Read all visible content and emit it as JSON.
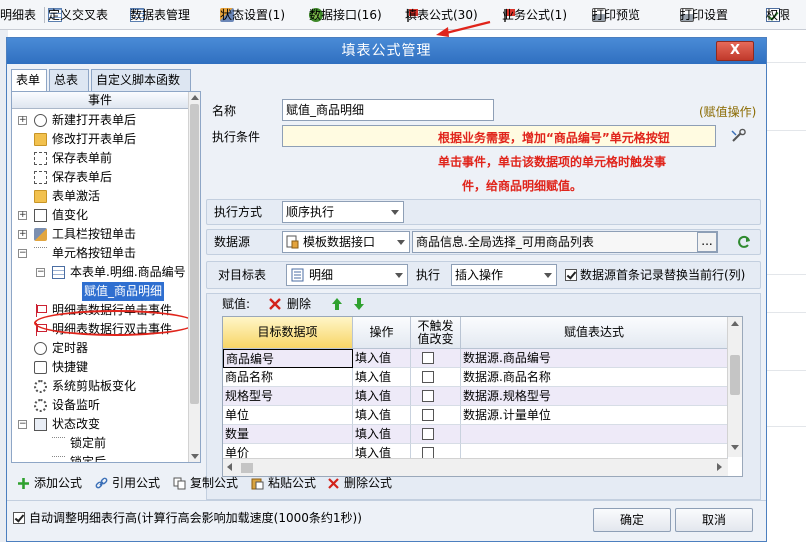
{
  "app_toolbar": {
    "items": [
      {
        "label": "明细表",
        "icon": "document-icon"
      },
      {
        "label": "定义交叉表",
        "icon": "grid-icon"
      },
      {
        "label": "数据表管理",
        "icon": "table-icon"
      },
      {
        "label": "状态设置(1)",
        "icon": "tool-icon"
      },
      {
        "label": "数据接口(16)",
        "icon": "link-icon"
      },
      {
        "label": "填表公式(30)",
        "icon": "flag-icon"
      },
      {
        "label": "业务公式(1)",
        "icon": "flag-icon"
      },
      {
        "label": "打印预览",
        "icon": "print-icon"
      },
      {
        "label": "打印设置",
        "icon": "print-icon"
      },
      {
        "label": "权限",
        "icon": "check-icon"
      }
    ]
  },
  "dialog": {
    "title": "填表公式管理",
    "close_label": "X",
    "tabs": [
      "表单",
      "总表",
      "自定义脚本函数"
    ],
    "active_tab": 0
  },
  "tree": {
    "header": "事件",
    "items": [
      {
        "label": "新建打开表单后",
        "icon": "user-icon",
        "level": 0,
        "expander": "+"
      },
      {
        "label": "修改打开表单后",
        "icon": "folder-icon",
        "level": 0,
        "expander": ""
      },
      {
        "label": "保存表单前",
        "icon": "save-icon",
        "level": 0,
        "expander": ""
      },
      {
        "label": "保存表单后",
        "icon": "save-icon",
        "level": 0,
        "expander": ""
      },
      {
        "label": "表单激活",
        "icon": "folder-icon",
        "level": 0,
        "expander": ""
      },
      {
        "label": "值变化",
        "icon": "page-icon",
        "level": 0,
        "expander": "+"
      },
      {
        "label": "工具栏按钮单击",
        "icon": "tool-icon",
        "level": 0,
        "expander": "+"
      },
      {
        "label": "单元格按钮单击",
        "icon": "dots-icon",
        "level": 0,
        "expander": "−"
      },
      {
        "label": "本表单.明细.商品编号",
        "icon": "form-icon",
        "level": 1,
        "expander": "−"
      },
      {
        "label": "赋值_商品明细",
        "icon": "",
        "level": 2,
        "expander": "",
        "selected": true
      },
      {
        "label": "明细表数据行单击事件",
        "icon": "flag-icon",
        "level": 0,
        "expander": ""
      },
      {
        "label": "明细表数据行双击事件",
        "icon": "flag-icon",
        "level": 0,
        "expander": ""
      },
      {
        "label": "定时器",
        "icon": "clock-icon",
        "level": 0,
        "expander": ""
      },
      {
        "label": "快捷键",
        "icon": "key-icon",
        "level": 0,
        "expander": ""
      },
      {
        "label": "系统剪贴板变化",
        "icon": "gear-icon",
        "level": 0,
        "expander": ""
      },
      {
        "label": "设备监听",
        "icon": "gear-icon",
        "level": 0,
        "expander": ""
      },
      {
        "label": "状态改变",
        "icon": "monitor-icon",
        "level": 0,
        "expander": "−"
      },
      {
        "label": "锁定前",
        "icon": "dots-icon",
        "level": 1,
        "expander": ""
      },
      {
        "label": "锁定后",
        "icon": "dots-icon",
        "level": 1,
        "expander": ""
      }
    ]
  },
  "form": {
    "name_label": "名称",
    "name_value": "赋值_商品明细",
    "name_tag": "(赋值操作)",
    "condition_label": "执行条件",
    "condition_value": "",
    "hints": [
      "根据业务需要，增加“商品编号”单元格按钮",
      "单击事件，单击该数据项的单元格时触发事",
      "件，给商品明细赋值。"
    ],
    "exec_mode_label": "执行方式",
    "exec_mode_value": "顺序执行",
    "datasource_label": "数据源",
    "datasource_type": "模板数据接口",
    "datasource_value": "商品信息.全局选择_可用商品列表",
    "browse_label": "...",
    "target_label": "对目标表",
    "target_value": "明细",
    "exec_label": "执行",
    "exec_value": "插入操作",
    "replace_check_label": "数据源首条记录替换当前行(列)",
    "replace_checked": true
  },
  "grid": {
    "toolbar_label": "赋值:",
    "delete_label": "删除",
    "columns": [
      "目标数据项",
      "操作",
      "不触发值改变",
      "赋值表达式"
    ],
    "rows": [
      {
        "target": "商品编号",
        "op": "填入值",
        "no_trigger": false,
        "expr": "数据源.商品编号"
      },
      {
        "target": "商品名称",
        "op": "填入值",
        "no_trigger": false,
        "expr": "数据源.商品名称"
      },
      {
        "target": "规格型号",
        "op": "填入值",
        "no_trigger": false,
        "expr": "数据源.规格型号"
      },
      {
        "target": "单位",
        "op": "填入值",
        "no_trigger": false,
        "expr": "数据源.计量单位"
      },
      {
        "target": "数量",
        "op": "填入值",
        "no_trigger": false,
        "expr": ""
      },
      {
        "target": "单价",
        "op": "填入值",
        "no_trigger": false,
        "expr": ""
      }
    ]
  },
  "bottom_tools": {
    "add": "添加公式",
    "ref": "引用公式",
    "copy": "复制公式",
    "paste": "粘贴公式",
    "delete": "删除公式"
  },
  "footer": {
    "auto_height_label": "自动调整明细表行高(计算行高会影响加载速度(1000条约1秒))",
    "auto_height_checked": true,
    "ok_label": "确定",
    "cancel_label": "取消"
  },
  "colors": {
    "title_bar": "#2f6fc0",
    "hint_text": "#e0241b",
    "selection": "#2f6fd0",
    "highlight_header": "#f7d566"
  }
}
